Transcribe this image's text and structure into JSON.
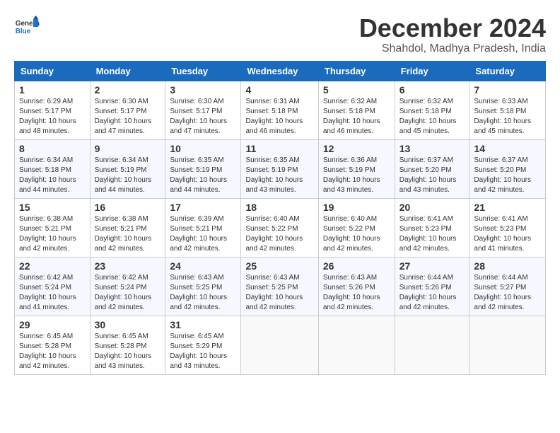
{
  "header": {
    "logo_general": "General",
    "logo_blue": "Blue",
    "title": "December 2024",
    "subtitle": "Shahdol, Madhya Pradesh, India"
  },
  "calendar": {
    "headers": [
      "Sunday",
      "Monday",
      "Tuesday",
      "Wednesday",
      "Thursday",
      "Friday",
      "Saturday"
    ],
    "weeks": [
      [
        {
          "day": "",
          "details": ""
        },
        {
          "day": "2",
          "details": "Sunrise: 6:30 AM\nSunset: 5:17 PM\nDaylight: 10 hours\nand 47 minutes."
        },
        {
          "day": "3",
          "details": "Sunrise: 6:30 AM\nSunset: 5:17 PM\nDaylight: 10 hours\nand 47 minutes."
        },
        {
          "day": "4",
          "details": "Sunrise: 6:31 AM\nSunset: 5:18 PM\nDaylight: 10 hours\nand 46 minutes."
        },
        {
          "day": "5",
          "details": "Sunrise: 6:32 AM\nSunset: 5:18 PM\nDaylight: 10 hours\nand 46 minutes."
        },
        {
          "day": "6",
          "details": "Sunrise: 6:32 AM\nSunset: 5:18 PM\nDaylight: 10 hours\nand 45 minutes."
        },
        {
          "day": "7",
          "details": "Sunrise: 6:33 AM\nSunset: 5:18 PM\nDaylight: 10 hours\nand 45 minutes."
        }
      ],
      [
        {
          "day": "1",
          "details": "Sunrise: 6:29 AM\nSunset: 5:17 PM\nDaylight: 10 hours\nand 48 minutes."
        },
        {
          "day": "",
          "details": ""
        },
        {
          "day": "",
          "details": ""
        },
        {
          "day": "",
          "details": ""
        },
        {
          "day": "",
          "details": ""
        },
        {
          "day": "",
          "details": ""
        },
        {
          "day": "",
          "details": ""
        }
      ],
      [
        {
          "day": "8",
          "details": "Sunrise: 6:34 AM\nSunset: 5:18 PM\nDaylight: 10 hours\nand 44 minutes."
        },
        {
          "day": "9",
          "details": "Sunrise: 6:34 AM\nSunset: 5:19 PM\nDaylight: 10 hours\nand 44 minutes."
        },
        {
          "day": "10",
          "details": "Sunrise: 6:35 AM\nSunset: 5:19 PM\nDaylight: 10 hours\nand 44 minutes."
        },
        {
          "day": "11",
          "details": "Sunrise: 6:35 AM\nSunset: 5:19 PM\nDaylight: 10 hours\nand 43 minutes."
        },
        {
          "day": "12",
          "details": "Sunrise: 6:36 AM\nSunset: 5:19 PM\nDaylight: 10 hours\nand 43 minutes."
        },
        {
          "day": "13",
          "details": "Sunrise: 6:37 AM\nSunset: 5:20 PM\nDaylight: 10 hours\nand 43 minutes."
        },
        {
          "day": "14",
          "details": "Sunrise: 6:37 AM\nSunset: 5:20 PM\nDaylight: 10 hours\nand 42 minutes."
        }
      ],
      [
        {
          "day": "15",
          "details": "Sunrise: 6:38 AM\nSunset: 5:21 PM\nDaylight: 10 hours\nand 42 minutes."
        },
        {
          "day": "16",
          "details": "Sunrise: 6:38 AM\nSunset: 5:21 PM\nDaylight: 10 hours\nand 42 minutes."
        },
        {
          "day": "17",
          "details": "Sunrise: 6:39 AM\nSunset: 5:21 PM\nDaylight: 10 hours\nand 42 minutes."
        },
        {
          "day": "18",
          "details": "Sunrise: 6:40 AM\nSunset: 5:22 PM\nDaylight: 10 hours\nand 42 minutes."
        },
        {
          "day": "19",
          "details": "Sunrise: 6:40 AM\nSunset: 5:22 PM\nDaylight: 10 hours\nand 42 minutes."
        },
        {
          "day": "20",
          "details": "Sunrise: 6:41 AM\nSunset: 5:23 PM\nDaylight: 10 hours\nand 42 minutes."
        },
        {
          "day": "21",
          "details": "Sunrise: 6:41 AM\nSunset: 5:23 PM\nDaylight: 10 hours\nand 41 minutes."
        }
      ],
      [
        {
          "day": "22",
          "details": "Sunrise: 6:42 AM\nSunset: 5:24 PM\nDaylight: 10 hours\nand 41 minutes."
        },
        {
          "day": "23",
          "details": "Sunrise: 6:42 AM\nSunset: 5:24 PM\nDaylight: 10 hours\nand 42 minutes."
        },
        {
          "day": "24",
          "details": "Sunrise: 6:43 AM\nSunset: 5:25 PM\nDaylight: 10 hours\nand 42 minutes."
        },
        {
          "day": "25",
          "details": "Sunrise: 6:43 AM\nSunset: 5:25 PM\nDaylight: 10 hours\nand 42 minutes."
        },
        {
          "day": "26",
          "details": "Sunrise: 6:43 AM\nSunset: 5:26 PM\nDaylight: 10 hours\nand 42 minutes."
        },
        {
          "day": "27",
          "details": "Sunrise: 6:44 AM\nSunset: 5:26 PM\nDaylight: 10 hours\nand 42 minutes."
        },
        {
          "day": "28",
          "details": "Sunrise: 6:44 AM\nSunset: 5:27 PM\nDaylight: 10 hours\nand 42 minutes."
        }
      ],
      [
        {
          "day": "29",
          "details": "Sunrise: 6:45 AM\nSunset: 5:28 PM\nDaylight: 10 hours\nand 42 minutes."
        },
        {
          "day": "30",
          "details": "Sunrise: 6:45 AM\nSunset: 5:28 PM\nDaylight: 10 hours\nand 43 minutes."
        },
        {
          "day": "31",
          "details": "Sunrise: 6:45 AM\nSunset: 5:29 PM\nDaylight: 10 hours\nand 43 minutes."
        },
        {
          "day": "",
          "details": ""
        },
        {
          "day": "",
          "details": ""
        },
        {
          "day": "",
          "details": ""
        },
        {
          "day": "",
          "details": ""
        }
      ]
    ]
  }
}
